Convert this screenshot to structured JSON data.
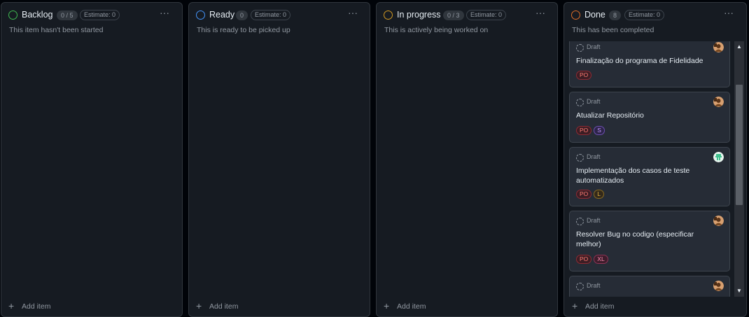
{
  "columns": [
    {
      "title": "Backlog",
      "count": "0 / 5",
      "estimate": "Estimate: 0",
      "description": "This item hasn't been started",
      "status_color": "#3fb950",
      "menu_icon": "ellipsis-icon",
      "add_item": "Add item"
    },
    {
      "title": "Ready",
      "count": "0",
      "estimate": "Estimate: 0",
      "description": "This is ready to be picked up",
      "status_color": "#4493f8",
      "menu_icon": "ellipsis-icon",
      "add_item": "Add item"
    },
    {
      "title": "In progress",
      "count": "0 / 3",
      "estimate": "Estimate: 0",
      "description": "This is actively being worked on",
      "status_color": "#d29922",
      "menu_icon": "ellipsis-icon",
      "add_item": "Add item"
    },
    {
      "title": "Done",
      "count": "8",
      "estimate": "Estimate: 0",
      "description": "This has been completed",
      "status_color": "#db6d28",
      "menu_icon": "ellipsis-icon",
      "add_item": "Add item",
      "cards": [
        {
          "draft": "Draft",
          "title": "Finalização do programa de Fidelidade",
          "labels": [
            "PO"
          ]
        },
        {
          "draft": "Draft",
          "title": "Atualizar Repositório",
          "labels": [
            "PO",
            "S"
          ]
        },
        {
          "draft": "Draft",
          "title": "Implementação dos casos de teste automatizados",
          "labels": [
            "PO",
            "L"
          ]
        },
        {
          "draft": "Draft",
          "title": "Resolver Bug no codigo (especificar melhor)",
          "labels": [
            "PO",
            "XL"
          ]
        },
        {
          "draft": "Draft",
          "title": "",
          "labels": []
        }
      ]
    }
  ],
  "glyphs": {
    "menu": "···",
    "plus": "+",
    "scroll_up": "▲",
    "scroll_down": "▼"
  }
}
